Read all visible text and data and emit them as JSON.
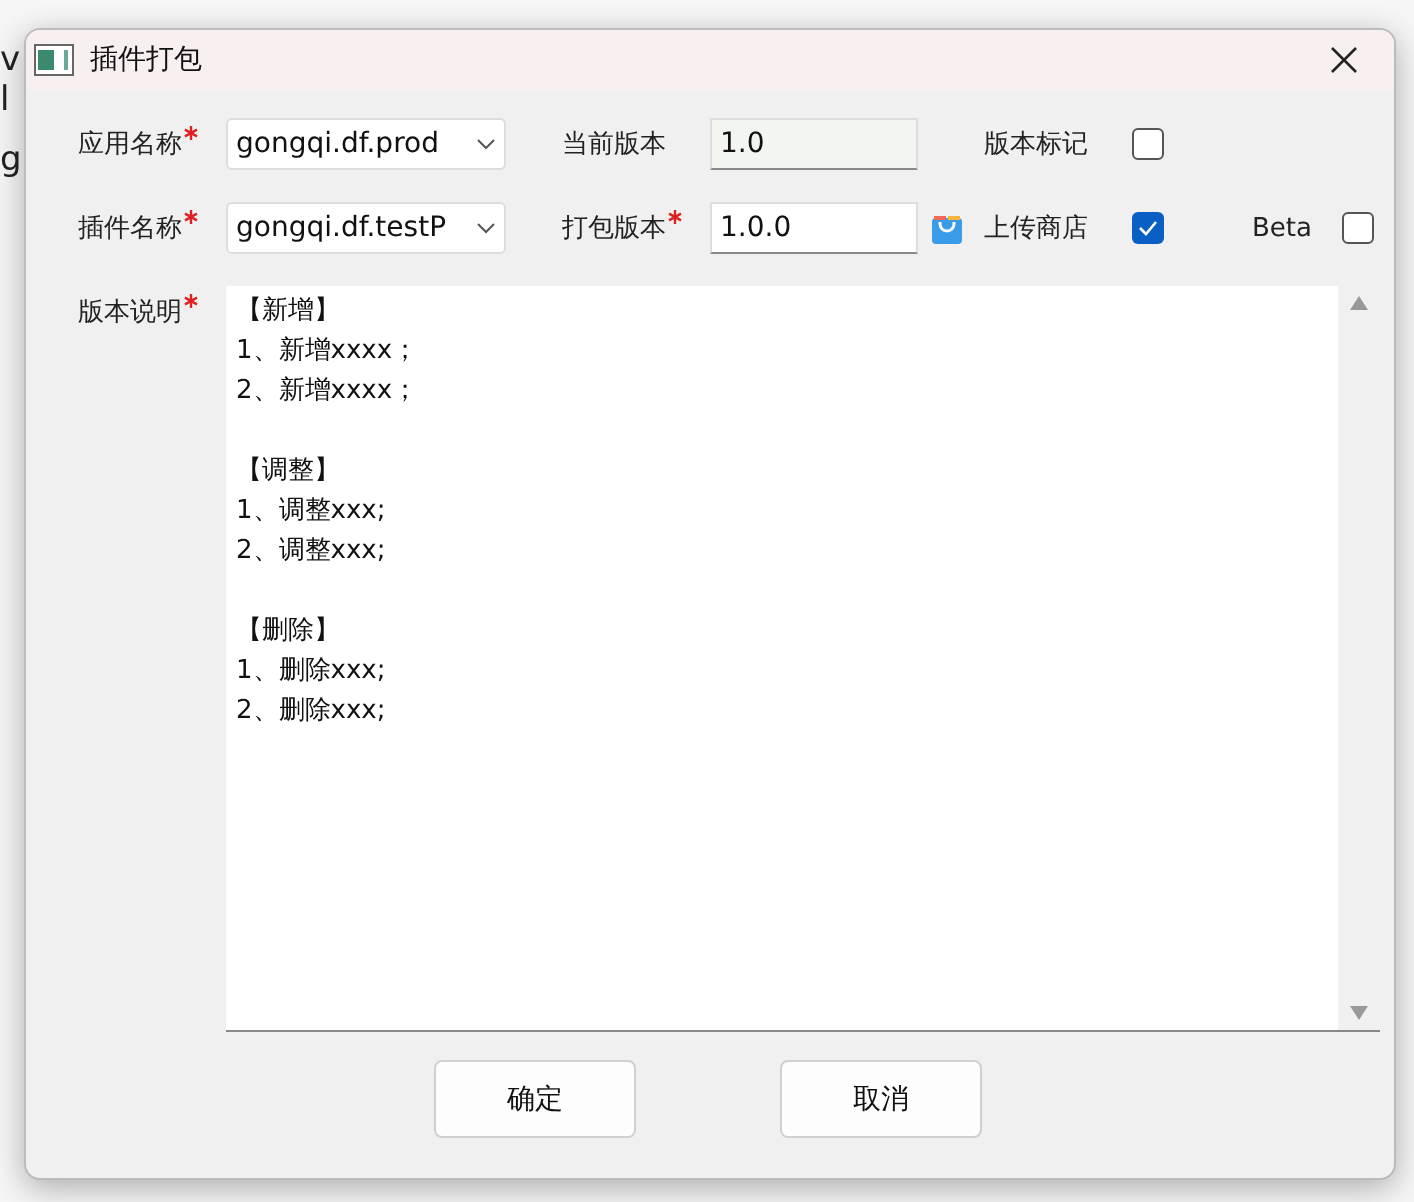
{
  "background": {
    "left_fragments": [
      "v",
      "l",
      "g"
    ]
  },
  "window": {
    "title": "插件打包"
  },
  "fields": [
    {
      "kind": "combo",
      "label": "应用名称",
      "required": true,
      "value": "gongqi.df.prod"
    },
    {
      "kind": "readonly",
      "label": "当前版本",
      "required": false,
      "value": "1.0"
    },
    {
      "kind": "checkbox",
      "label": "版本标记",
      "checked": false
    },
    {
      "kind": "combo",
      "label": "插件名称",
      "required": true,
      "value": "gongqi.df.testP"
    },
    {
      "kind": "input",
      "label": "打包版本",
      "required": true,
      "value": "1.0.0"
    },
    {
      "kind": "checkbox",
      "label": "上传商店",
      "checked": true
    },
    {
      "kind": "checkbox",
      "label": "Beta",
      "checked": false
    }
  ],
  "notes": {
    "label": "版本说明",
    "required": true,
    "sections": [
      {
        "lines": [
          "【新增】",
          "1、新增xxxx；",
          "2、新增xxxx；"
        ]
      },
      {
        "lines": [
          "【调整】",
          "1、调整xxx;",
          "2、调整xxx;"
        ]
      },
      {
        "lines": [
          "【删除】",
          "1、删除xxx;",
          "2、删除xxx;"
        ]
      }
    ]
  },
  "buttons": [
    "确定",
    "取消"
  ]
}
